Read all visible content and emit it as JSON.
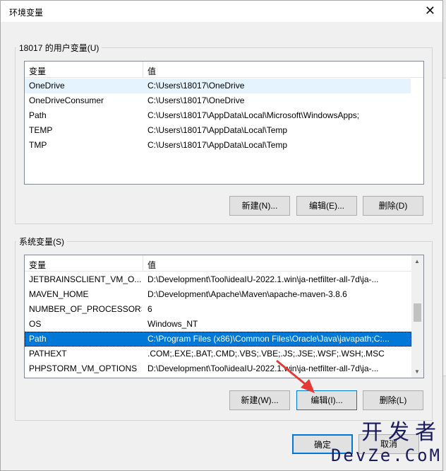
{
  "window": {
    "title": "环境变量",
    "close_glyph": "✕"
  },
  "user_group": {
    "legend": "18017 的用户变量(U)",
    "columns": {
      "name": "变量",
      "value": "值"
    },
    "rows": [
      {
        "name": "OneDrive",
        "value": "C:\\Users\\18017\\OneDrive"
      },
      {
        "name": "OneDriveConsumer",
        "value": "C:\\Users\\18017\\OneDrive"
      },
      {
        "name": "Path",
        "value": "C:\\Users\\18017\\AppData\\Local\\Microsoft\\WindowsApps;"
      },
      {
        "name": "TEMP",
        "value": "C:\\Users\\18017\\AppData\\Local\\Temp"
      },
      {
        "name": "TMP",
        "value": "C:\\Users\\18017\\AppData\\Local\\Temp"
      }
    ],
    "buttons": {
      "new": "新建(N)...",
      "edit": "编辑(E)...",
      "delete": "删除(D)"
    }
  },
  "system_group": {
    "legend": "系统变量(S)",
    "columns": {
      "name": "变量",
      "value": "值"
    },
    "rows": [
      {
        "name": "JETBRAINSCLIENT_VM_O...",
        "value": "D:\\Development\\Tool\\ideaIU-2022.1.win\\ja-netfilter-all-7d\\ja-..."
      },
      {
        "name": "MAVEN_HOME",
        "value": "D:\\Development\\Apache\\Maven\\apache-maven-3.8.6"
      },
      {
        "name": "NUMBER_OF_PROCESSORS",
        "value": "6"
      },
      {
        "name": "OS",
        "value": "Windows_NT"
      },
      {
        "name": "Path",
        "value": "C:\\Program Files (x86)\\Common Files\\Oracle\\Java\\javapath;C:..."
      },
      {
        "name": "PATHEXT",
        "value": ".COM;.EXE;.BAT;.CMD;.VBS;.VBE;.JS;.JSE;.WSF;.WSH;.MSC"
      },
      {
        "name": "PHPSTORM_VM_OPTIONS",
        "value": "D:\\Development\\Tool\\ideaIU-2022.1.win\\ja-netfilter-all-7d\\ja-..."
      }
    ],
    "buttons": {
      "new": "新建(W)...",
      "edit": "编辑(I)...",
      "delete": "删除(L)"
    }
  },
  "footer": {
    "ok": "确定",
    "cancel": "取消"
  },
  "watermark": {
    "cn": "开发者",
    "en": "DevZe.CoM"
  },
  "colors": {
    "selection": "#0078d7",
    "arrow": "#e53935"
  }
}
